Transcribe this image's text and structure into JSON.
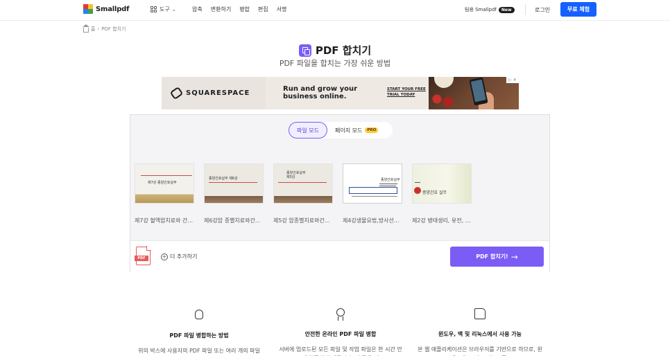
{
  "header": {
    "logo_text": "Smallpdf",
    "tools_label": "도구",
    "nav": [
      "압축",
      "변환하기",
      "병합",
      "편집",
      "서명"
    ],
    "team_label": "팀용 Smallpdf",
    "new_badge": "New",
    "login_label": "로그인",
    "trial_label": "무료 체험"
  },
  "breadcrumb": {
    "home": "홈",
    "separator": "›",
    "current": "PDF 합치기"
  },
  "page": {
    "title": "PDF 합치기",
    "subtitle": "PDF 파일을 합치는 가장 쉬운 방법"
  },
  "ad": {
    "brand": "SQUARESPACE",
    "headline": "Run and grow your business online.",
    "cta": "START YOUR FREE TRIAL TODAY",
    "choices": "▷ ✕"
  },
  "tool": {
    "mode_file": "파일 모드",
    "mode_page": "페이지 모드",
    "pro_badge": "PRO",
    "files": [
      {
        "name": "제7강 혈액암치료와 간...",
        "thumb_title": "제7강 종양간호실무"
      },
      {
        "name": "제6강암 종별치료와간...",
        "thumb_title": "종양간호실무 제6강"
      },
      {
        "name": "제5강 암종별치료와간...",
        "thumb_title": "종양간호실무 제5강"
      },
      {
        "name": "제4강생물요법,방사선...",
        "thumb_title": "종양간호실무"
      },
      {
        "name": "제2강 병태생리, 유전, ...",
        "thumb_title": "종양간호 실무"
      }
    ],
    "add_more": "더 추가하기",
    "pdf_label": "PDF",
    "merge_button": "PDF 합치기!",
    "merge_arrow": "→"
  },
  "features": [
    {
      "icon": "lightbulb-icon",
      "title": "PDF 파일 병합하는 방법",
      "desc": "위의 박스에 사용자의 PDF 파일 또는 여러 개의 파일을 드래그 앤 드롭합니다. 페이지"
    },
    {
      "icon": "medal-icon",
      "title": "안전한 온라인 PDF 파일 병합",
      "desc": "서버에 업로드된 모든 파일 및 작업 파일은 한 시간 안에 영구히 삭제됩니다. 더 많은 정"
    },
    {
      "icon": "thumbs-up-icon",
      "title": "윈도우, 맥 및 리눅스에서 사용 가능",
      "desc": "본 웹 애플리케이션은 브라우저를 기반으로 하므로, 윈도우, 맥, 그리고 리눅스를 포"
    }
  ],
  "colors": {
    "accent": "#7b5cf5",
    "trial": "#1560ff",
    "pro": "#ffc83d"
  }
}
